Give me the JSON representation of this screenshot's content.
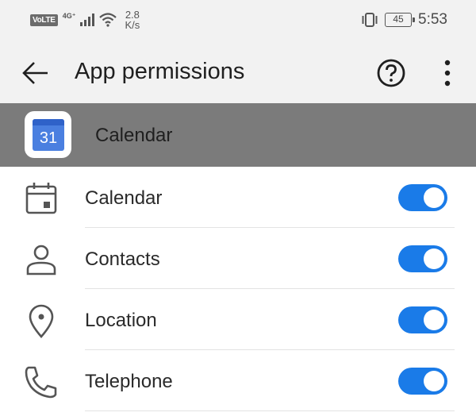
{
  "status_bar": {
    "volte": "VoLTE",
    "network": "4G⁺",
    "speed_value": "2.8",
    "speed_unit": "K/s",
    "battery": "45",
    "time": "5:53"
  },
  "app_bar": {
    "title": "App permissions",
    "back_icon": "arrow-left-icon",
    "help_icon": "help-circle-icon",
    "more_icon": "more-vertical-icon"
  },
  "app_header": {
    "app_name": "Calendar",
    "icon_number": "31"
  },
  "permissions": [
    {
      "label": "Calendar",
      "icon": "calendar-icon",
      "enabled": true
    },
    {
      "label": "Contacts",
      "icon": "contacts-icon",
      "enabled": true
    },
    {
      "label": "Location",
      "icon": "location-icon",
      "enabled": true
    },
    {
      "label": "Telephone",
      "icon": "telephone-icon",
      "enabled": true
    }
  ],
  "colors": {
    "toggle_on": "#1a7be8",
    "header_bg": "#7b7b7b",
    "bar_bg": "#f2f2f2"
  }
}
